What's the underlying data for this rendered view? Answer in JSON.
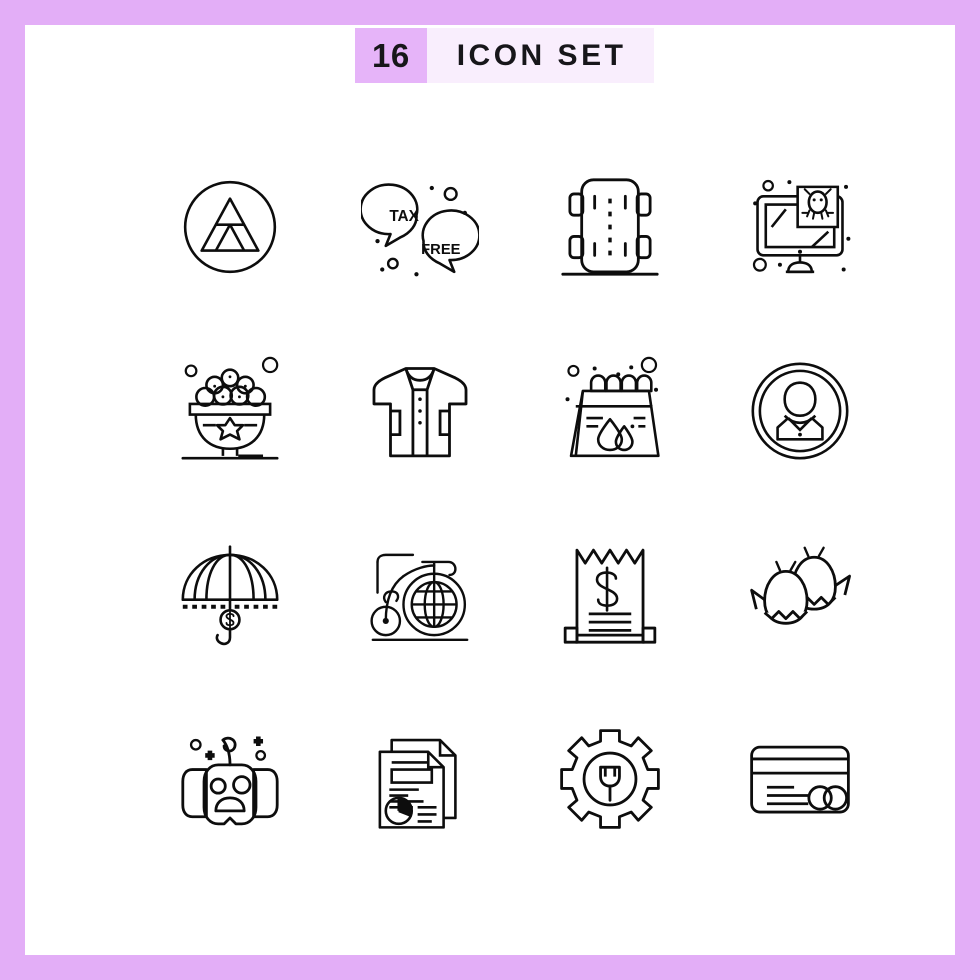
{
  "header": {
    "count": "16",
    "title": "ICON SET"
  },
  "colors": {
    "page_border": "#e3aef7",
    "canvas": "#ffffff",
    "badge_bg": "#e6b4f9",
    "title_bg": "#f9eefd",
    "text": "#17161a",
    "icon_stroke": "#0d0d0d"
  },
  "icons": [
    {
      "position": 1,
      "name": "triforce-circle-icon",
      "label": "Triangle in circle"
    },
    {
      "position": 2,
      "name": "tax-free-chat-bubbles-icon",
      "label": "Tax free speech bubbles",
      "text_primary": "TAX",
      "text_secondary": "FREE"
    },
    {
      "position": 3,
      "name": "car-top-view-icon",
      "label": "Car top view on road"
    },
    {
      "position": 4,
      "name": "computer-virus-icon",
      "label": "Computer monitor with virus"
    },
    {
      "position": 5,
      "name": "sweets-bowl-icon",
      "label": "Bowl of sweets"
    },
    {
      "position": 6,
      "name": "tshirt-icon",
      "label": "T-shirt"
    },
    {
      "position": 7,
      "name": "calendar-water-drop-icon",
      "label": "Calendar with water drops"
    },
    {
      "position": 8,
      "name": "user-avatar-circle-icon",
      "label": "User avatar in circle"
    },
    {
      "position": 9,
      "name": "umbrella-dollar-icon",
      "label": "Umbrella with dollar"
    },
    {
      "position": 10,
      "name": "penny-farthing-globe-icon",
      "label": "Penny farthing bicycle with globe wheel"
    },
    {
      "position": 11,
      "name": "receipt-dollar-icon",
      "label": "Receipt with dollar sign"
    },
    {
      "position": 12,
      "name": "easter-eggs-icon",
      "label": "Cracked easter eggs"
    },
    {
      "position": 13,
      "name": "pumpkin-lantern-icon",
      "label": "Halloween pumpkin"
    },
    {
      "position": 14,
      "name": "report-documents-icon",
      "label": "Documents with pie chart"
    },
    {
      "position": 15,
      "name": "gear-plug-icon",
      "label": "Gear with electric plug"
    },
    {
      "position": 16,
      "name": "credit-card-icon",
      "label": "Credit card"
    }
  ]
}
